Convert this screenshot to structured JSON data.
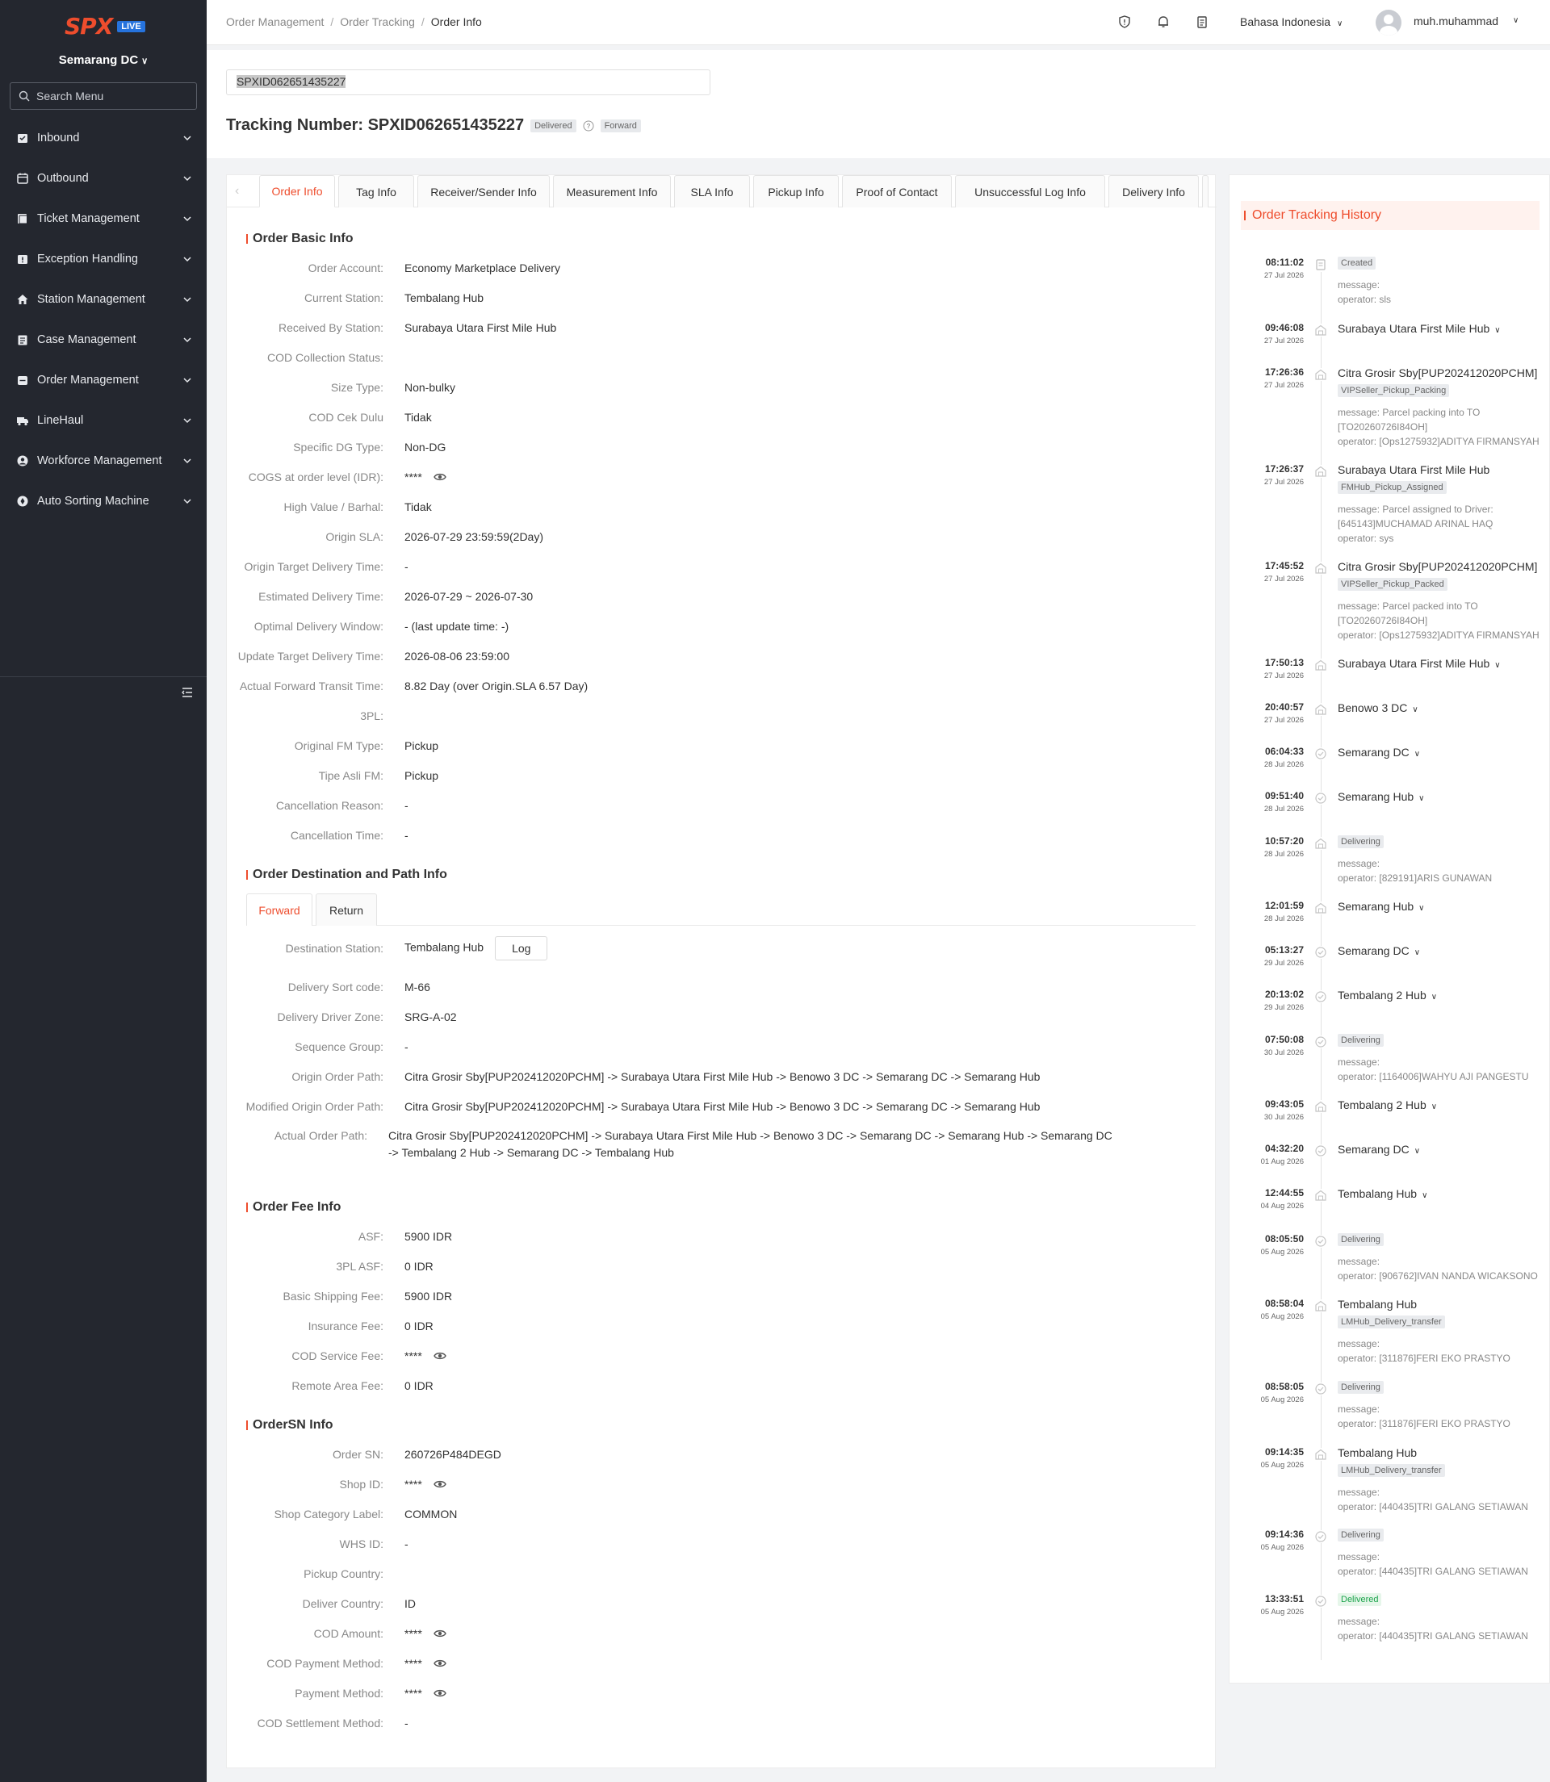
{
  "sidebar": {
    "logo": "SPX",
    "live": "LIVE",
    "station": "Semarang DC",
    "search_placeholder": "Search Menu",
    "items": [
      {
        "label": "Inbound",
        "icon": "inbound-icon"
      },
      {
        "label": "Outbound",
        "icon": "outbound-icon"
      },
      {
        "label": "Ticket Management",
        "icon": "ticket-icon"
      },
      {
        "label": "Exception Handling",
        "icon": "exception-icon"
      },
      {
        "label": "Station Management",
        "icon": "home-icon"
      },
      {
        "label": "Case Management",
        "icon": "case-icon"
      },
      {
        "label": "Order Management",
        "icon": "order-icon"
      },
      {
        "label": "LineHaul",
        "icon": "truck-icon"
      },
      {
        "label": "Workforce Management",
        "icon": "user-circle-icon"
      },
      {
        "label": "Auto Sorting Machine",
        "icon": "sorting-icon"
      }
    ]
  },
  "header": {
    "breadcrumb": [
      "Order Management",
      "Order Tracking",
      "Order Info"
    ],
    "language": "Bahasa Indonesia",
    "username": "muh.muhammad"
  },
  "tracking": {
    "input_value": "SPXID062651435227",
    "title": "Tracking Number: SPXID062651435227",
    "status_badge": "Delivered",
    "direction_badge": "Forward"
  },
  "tabs": [
    "Order Info",
    "Tag Info",
    "Receiver/Sender Info",
    "Measurement Info",
    "SLA Info",
    "Pickup Info",
    "Proof of Contact",
    "Unsuccessful Log Info",
    "Delivery Info"
  ],
  "basic_info": {
    "title": "Order Basic Info",
    "rows": [
      {
        "k": "Order Account:",
        "v": "Economy Marketplace Delivery"
      },
      {
        "k": "Current Station:",
        "v": "Tembalang Hub"
      },
      {
        "k": "Received By Station:",
        "v": "Surabaya Utara First Mile Hub"
      },
      {
        "k": "COD Collection Status:",
        "v": ""
      },
      {
        "k": "Size Type:",
        "v": "Non-bulky"
      },
      {
        "k": "COD Cek Dulu",
        "v": "Tidak"
      },
      {
        "k": "Specific DG Type:",
        "v": "Non-DG"
      },
      {
        "k": "COGS at order level (IDR):",
        "v": "****",
        "eye": true
      },
      {
        "k": "High Value / Barhal:",
        "v": "Tidak"
      },
      {
        "k": "Origin SLA:",
        "v": "2026-07-29 23:59:59(2Day)"
      },
      {
        "k": "Origin Target Delivery Time:",
        "v": "-"
      },
      {
        "k": "Estimated Delivery Time:",
        "v": "2026-07-29 ~ 2026-07-30"
      },
      {
        "k": "Optimal Delivery Window:",
        "v": "- (last update time: -)"
      },
      {
        "k": "Update Target Delivery Time:",
        "v": "2026-08-06 23:59:00"
      },
      {
        "k": "Actual Forward Transit Time:",
        "v": "8.82 Day (over Origin.SLA 6.57 Day)"
      },
      {
        "k": "3PL:",
        "v": ""
      },
      {
        "k": "Original FM Type:",
        "v": "Pickup"
      },
      {
        "k": "Tipe Asli FM:",
        "v": "Pickup"
      },
      {
        "k": "Cancellation Reason:",
        "v": "-"
      },
      {
        "k": "Cancellation Time:",
        "v": "-"
      }
    ]
  },
  "destination": {
    "title": "Order Destination and Path Info",
    "subtabs": [
      "Forward",
      "Return"
    ],
    "station_label": "Destination Station:",
    "station_value": "Tembalang Hub",
    "log_button": "Log",
    "rows": [
      {
        "k": "Delivery Sort code:",
        "v": "M-66"
      },
      {
        "k": "Delivery Driver Zone:",
        "v": "SRG-A-02"
      },
      {
        "k": "Sequence Group:",
        "v": "-"
      },
      {
        "k": "Origin Order Path:",
        "v": "Citra Grosir Sby[PUP202412020PCHM]  -> Surabaya Utara First Mile Hub  -> Benowo 3 DC  -> Semarang DC  -> Semarang Hub"
      },
      {
        "k": "Modified Origin Order Path:",
        "v": "Citra Grosir Sby[PUP202412020PCHM]  -> Surabaya Utara First Mile Hub  -> Benowo 3 DC  -> Semarang DC  -> Semarang Hub"
      }
    ],
    "actual_path_label": "Actual Order Path:",
    "actual_path_value": "Citra Grosir Sby[PUP202412020PCHM]  -> Surabaya Utara First Mile Hub  -> Benowo 3 DC  -> Semarang DC  -> Semarang Hub  -> Semarang DC  -> Tembalang 2 Hub  -> Semarang DC  -> Tembalang Hub"
  },
  "fee_info": {
    "title": "Order Fee Info",
    "rows": [
      {
        "k": "ASF:",
        "v": "5900 IDR"
      },
      {
        "k": "3PL ASF:",
        "v": "0 IDR"
      },
      {
        "k": "Basic Shipping Fee:",
        "v": "5900 IDR"
      },
      {
        "k": "Insurance Fee:",
        "v": "0 IDR"
      },
      {
        "k": "COD Service Fee:",
        "v": "****",
        "eye": true
      },
      {
        "k": "Remote Area Fee:",
        "v": "0 IDR"
      }
    ]
  },
  "ordersn_info": {
    "title": "OrderSN Info",
    "rows": [
      {
        "k": "Order SN:",
        "v": "260726P484DEGD"
      },
      {
        "k": "Shop ID:",
        "v": "****",
        "eye": true
      },
      {
        "k": "Shop Category Label:",
        "v": "COMMON"
      },
      {
        "k": "WHS ID:",
        "v": "-"
      },
      {
        "k": "Pickup Country:",
        "v": ""
      },
      {
        "k": "Deliver Country:",
        "v": "ID"
      },
      {
        "k": "COD Amount:",
        "v": "****",
        "eye": true
      },
      {
        "k": "COD Payment Method:",
        "v": "****",
        "eye": true
      },
      {
        "k": "Payment Method:",
        "v": "****",
        "eye": true
      },
      {
        "k": "COD Settlement Method:",
        "v": "-"
      }
    ]
  },
  "history": {
    "title": "Order Tracking History",
    "events": [
      {
        "time": "08:11:02",
        "date": "27 Jul 2026",
        "icon": "document-icon",
        "tag": "Created",
        "msg": [
          "message:",
          "operator: sls"
        ]
      },
      {
        "time": "09:46:08",
        "date": "27 Jul 2026",
        "icon": "warehouse-icon",
        "title": "Surabaya Utara First Mile Hub",
        "chev": true
      },
      {
        "time": "17:26:36",
        "date": "27 Jul 2026",
        "icon": "warehouse-icon",
        "title": "Citra Grosir Sby[PUP202412020PCHM]",
        "tag": "VIPSeller_Pickup_Packing",
        "msg": [
          "message: Parcel packing into TO [TO20260726I84OH]",
          "operator: [Ops1275932]ADITYA FIRMANSYAH"
        ]
      },
      {
        "time": "17:26:37",
        "date": "27 Jul 2026",
        "icon": "warehouse-icon",
        "title": "Surabaya Utara First Mile Hub",
        "tag": "FMHub_Pickup_Assigned",
        "msg": [
          "message: Parcel assigned to Driver: [645143]MUCHAMAD ARINAL HAQ",
          "operator: sys"
        ]
      },
      {
        "time": "17:45:52",
        "date": "27 Jul 2026",
        "icon": "warehouse-icon",
        "title": "Citra Grosir Sby[PUP202412020PCHM]",
        "tag": "VIPSeller_Pickup_Packed",
        "msg": [
          "message: Parcel packed into TO [TO20260726I84OH]",
          "operator: [Ops1275932]ADITYA FIRMANSYAH"
        ]
      },
      {
        "time": "17:50:13",
        "date": "27 Jul 2026",
        "icon": "warehouse-icon",
        "title": "Surabaya Utara First Mile Hub",
        "chev": true
      },
      {
        "time": "20:40:57",
        "date": "27 Jul 2026",
        "icon": "warehouse-icon",
        "title": "Benowo 3 DC",
        "chev": true
      },
      {
        "time": "06:04:33",
        "date": "28 Jul 2026",
        "icon": "check-circle-icon",
        "title": "Semarang DC",
        "chev": true
      },
      {
        "time": "09:51:40",
        "date": "28 Jul 2026",
        "icon": "check-circle-icon",
        "title": "Semarang Hub",
        "chev": true
      },
      {
        "time": "10:57:20",
        "date": "28 Jul 2026",
        "icon": "warehouse-icon",
        "tag": "Delivering",
        "msg": [
          "message:",
          "operator: [829191]ARIS GUNAWAN"
        ]
      },
      {
        "time": "12:01:59",
        "date": "28 Jul 2026",
        "icon": "warehouse-icon",
        "title": "Semarang Hub",
        "chev": true
      },
      {
        "time": "05:13:27",
        "date": "29 Jul 2026",
        "icon": "check-circle-icon",
        "title": "Semarang DC",
        "chev": true
      },
      {
        "time": "20:13:02",
        "date": "29 Jul 2026",
        "icon": "check-circle-icon",
        "title": "Tembalang 2 Hub",
        "chev": true
      },
      {
        "time": "07:50:08",
        "date": "30 Jul 2026",
        "icon": "check-circle-icon",
        "tag": "Delivering",
        "msg": [
          "message:",
          "operator: [1164006]WAHYU AJI PANGESTU"
        ]
      },
      {
        "time": "09:43:05",
        "date": "30 Jul 2026",
        "icon": "warehouse-icon",
        "title": "Tembalang 2 Hub",
        "chev": true
      },
      {
        "time": "04:32:20",
        "date": "01 Aug 2026",
        "icon": "check-circle-icon",
        "title": "Semarang DC",
        "chev": true
      },
      {
        "time": "12:44:55",
        "date": "04 Aug 2026",
        "icon": "warehouse-icon",
        "title": "Tembalang Hub",
        "chev": true
      },
      {
        "time": "08:05:50",
        "date": "05 Aug 2026",
        "icon": "check-circle-icon",
        "tag": "Delivering",
        "msg": [
          "message:",
          "operator: [906762]IVAN NANDA WICAKSONO"
        ]
      },
      {
        "time": "08:58:04",
        "date": "05 Aug 2026",
        "icon": "warehouse-icon",
        "title": "Tembalang Hub",
        "tag": "LMHub_Delivery_transfer",
        "msg": [
          "message:",
          "operator: [311876]FERI EKO PRASTYO"
        ]
      },
      {
        "time": "08:58:05",
        "date": "05 Aug 2026",
        "icon": "check-circle-icon",
        "tag": "Delivering",
        "msg": [
          "message:",
          "operator: [311876]FERI EKO PRASTYO"
        ]
      },
      {
        "time": "09:14:35",
        "date": "05 Aug 2026",
        "icon": "warehouse-icon",
        "title": "Tembalang Hub",
        "tag": "LMHub_Delivery_transfer",
        "msg": [
          "message:",
          "operator: [440435]TRI GALANG SETIAWAN"
        ]
      },
      {
        "time": "09:14:36",
        "date": "05 Aug 2026",
        "icon": "check-circle-icon",
        "tag": "Delivering",
        "msg": [
          "message:",
          "operator: [440435]TRI GALANG SETIAWAN"
        ]
      },
      {
        "time": "13:33:51",
        "date": "05 Aug 2026",
        "icon": "check-circle-icon",
        "tag": "Delivered",
        "tag_color": "green",
        "msg": [
          "message:",
          "operator: [440435]TRI GALANG SETIAWAN"
        ]
      }
    ]
  },
  "colors": {
    "accent": "#ee4d2d",
    "sidebar_bg": "#24272f",
    "live_badge": "#2673dd",
    "delivered_green": "#1aa34a"
  }
}
